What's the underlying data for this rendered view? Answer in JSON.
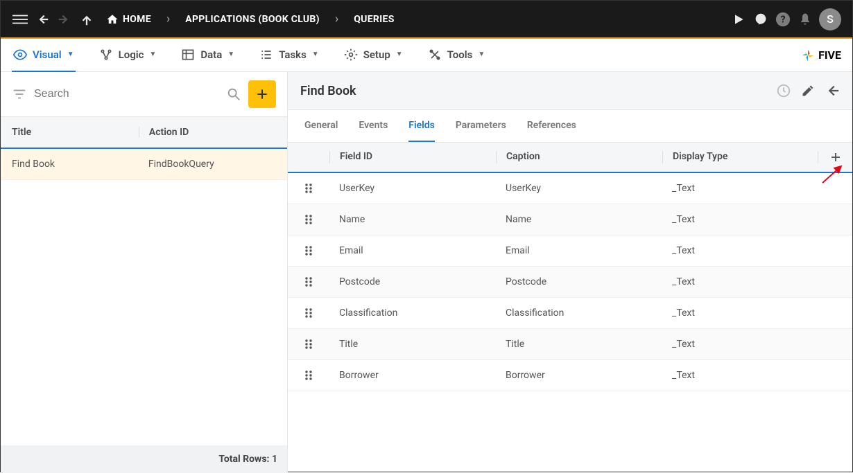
{
  "breadcrumbs": [
    {
      "label": "HOME",
      "has_home_icon": true
    },
    {
      "label": "APPLICATIONS (BOOK CLUB)"
    },
    {
      "label": "QUERIES"
    }
  ],
  "avatar_letter": "S",
  "main_tabs": [
    {
      "label": "Visual",
      "icon": "eye",
      "active": true
    },
    {
      "label": "Logic",
      "icon": "logic"
    },
    {
      "label": "Data",
      "icon": "grid"
    },
    {
      "label": "Tasks",
      "icon": "list"
    },
    {
      "label": "Setup",
      "icon": "gear"
    },
    {
      "label": "Tools",
      "icon": "wrench"
    }
  ],
  "brand": "FIVE",
  "left_panel": {
    "search_placeholder": "Search",
    "columns": {
      "title": "Title",
      "action_id": "Action ID"
    },
    "rows": [
      {
        "title": "Find Book",
        "action_id": "FindBookQuery",
        "selected": true
      }
    ],
    "footer_label": "Total Rows:",
    "footer_count": "1"
  },
  "right_panel": {
    "title": "Find Book",
    "sub_tabs": [
      {
        "label": "General"
      },
      {
        "label": "Events"
      },
      {
        "label": "Fields",
        "active": true
      },
      {
        "label": "Parameters"
      },
      {
        "label": "References"
      }
    ],
    "grid_headers": {
      "field_id": "Field ID",
      "caption": "Caption",
      "display_type": "Display Type"
    },
    "grid_rows": [
      {
        "field_id": "UserKey",
        "caption": "UserKey",
        "display_type": "_Text"
      },
      {
        "field_id": "Name",
        "caption": "Name",
        "display_type": "_Text"
      },
      {
        "field_id": "Email",
        "caption": "Email",
        "display_type": "_Text"
      },
      {
        "field_id": "Postcode",
        "caption": "Postcode",
        "display_type": "_Text"
      },
      {
        "field_id": "Classification",
        "caption": "Classification",
        "display_type": "_Text"
      },
      {
        "field_id": "Title",
        "caption": "Title",
        "display_type": "_Text"
      },
      {
        "field_id": "Borrower",
        "caption": "Borrower",
        "display_type": "_Text"
      }
    ]
  }
}
